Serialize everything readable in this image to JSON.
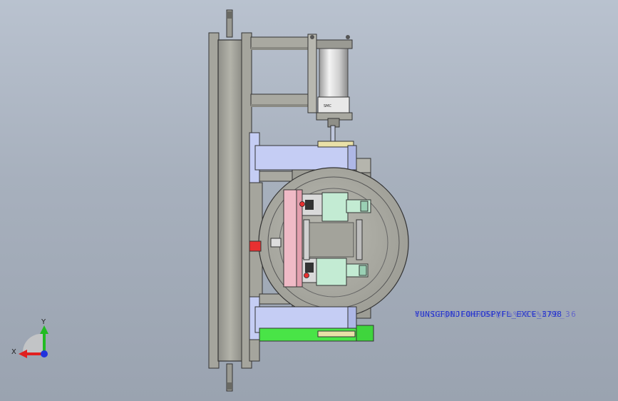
{
  "viewport": {
    "background_top": "#b9c2cf",
    "background_bottom": "#9aa3b0"
  },
  "colors": {
    "frame_gray": "#a9a9a1",
    "frame_dark": "#3f3f3f",
    "blue_arm": "#c5cdf4",
    "pink_plate": "#f0bac6",
    "green_block": "#c3ebd3",
    "green_bar": "#49e447",
    "red_part": "#e83030",
    "axis_x": "#e02020",
    "axis_y": "#22bb22",
    "axis_z": "#2233dd"
  },
  "overlay_text": {
    "line1": "0%(DE@EDEDEXBE@F%%FE%%EXB_36",
    "line2": "YUNSGFDNJFOHFDSPYFL_EXCE_3798"
  },
  "triad": {
    "x_label": "X",
    "y_label": "Y",
    "x_icon": "x-axis-arrow-icon",
    "y_icon": "y-axis-arrow-icon",
    "z_icon": "z-axis-dot-icon"
  }
}
